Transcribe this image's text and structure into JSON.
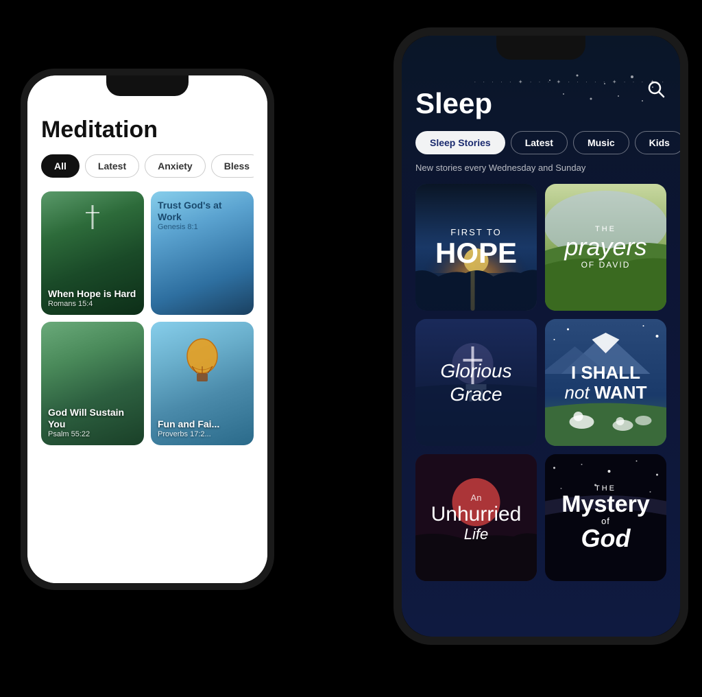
{
  "scene": {
    "bg": "#000"
  },
  "left_phone": {
    "title": "Meditation",
    "filters": [
      {
        "label": "All",
        "active": true
      },
      {
        "label": "Latest",
        "active": false
      },
      {
        "label": "Anxiety",
        "active": false
      },
      {
        "label": "Bless",
        "active": false
      }
    ],
    "cards": [
      {
        "title": "When Hope is Hard",
        "subtitle": "Romans 15:4"
      },
      {
        "title": "Trust God's at Work",
        "subtitle": "Genesis 8:1"
      },
      {
        "title": "God Will Sustain You",
        "subtitle": "Psalm 55:22"
      },
      {
        "title": "Fun and Fai...",
        "subtitle": "Proverbs 17:2..."
      }
    ]
  },
  "right_phone": {
    "title": "Sleep",
    "filters": [
      {
        "label": "Sleep Stories",
        "active": true
      },
      {
        "label": "Latest",
        "active": false
      },
      {
        "label": "Music",
        "active": false
      },
      {
        "label": "Kids",
        "active": false
      }
    ],
    "subtitle": "New stories every Wednesday and Sunday",
    "cards": [
      {
        "id": "hope",
        "line1": "FIRST TO",
        "line2": "HOPE"
      },
      {
        "id": "prayers",
        "the": "THE",
        "main": "prayers",
        "sub": "OF DAVID"
      },
      {
        "id": "glorious",
        "main": "Glorious Grace"
      },
      {
        "id": "shall",
        "main": "I SHALL",
        "italic": "not",
        "end": "WANT"
      },
      {
        "id": "unhurried",
        "an": "An",
        "main": "Unhurried",
        "life": "Life"
      },
      {
        "id": "mystery",
        "the": "THE",
        "main": "Mystery",
        "of": "of",
        "god": "God"
      }
    ]
  }
}
